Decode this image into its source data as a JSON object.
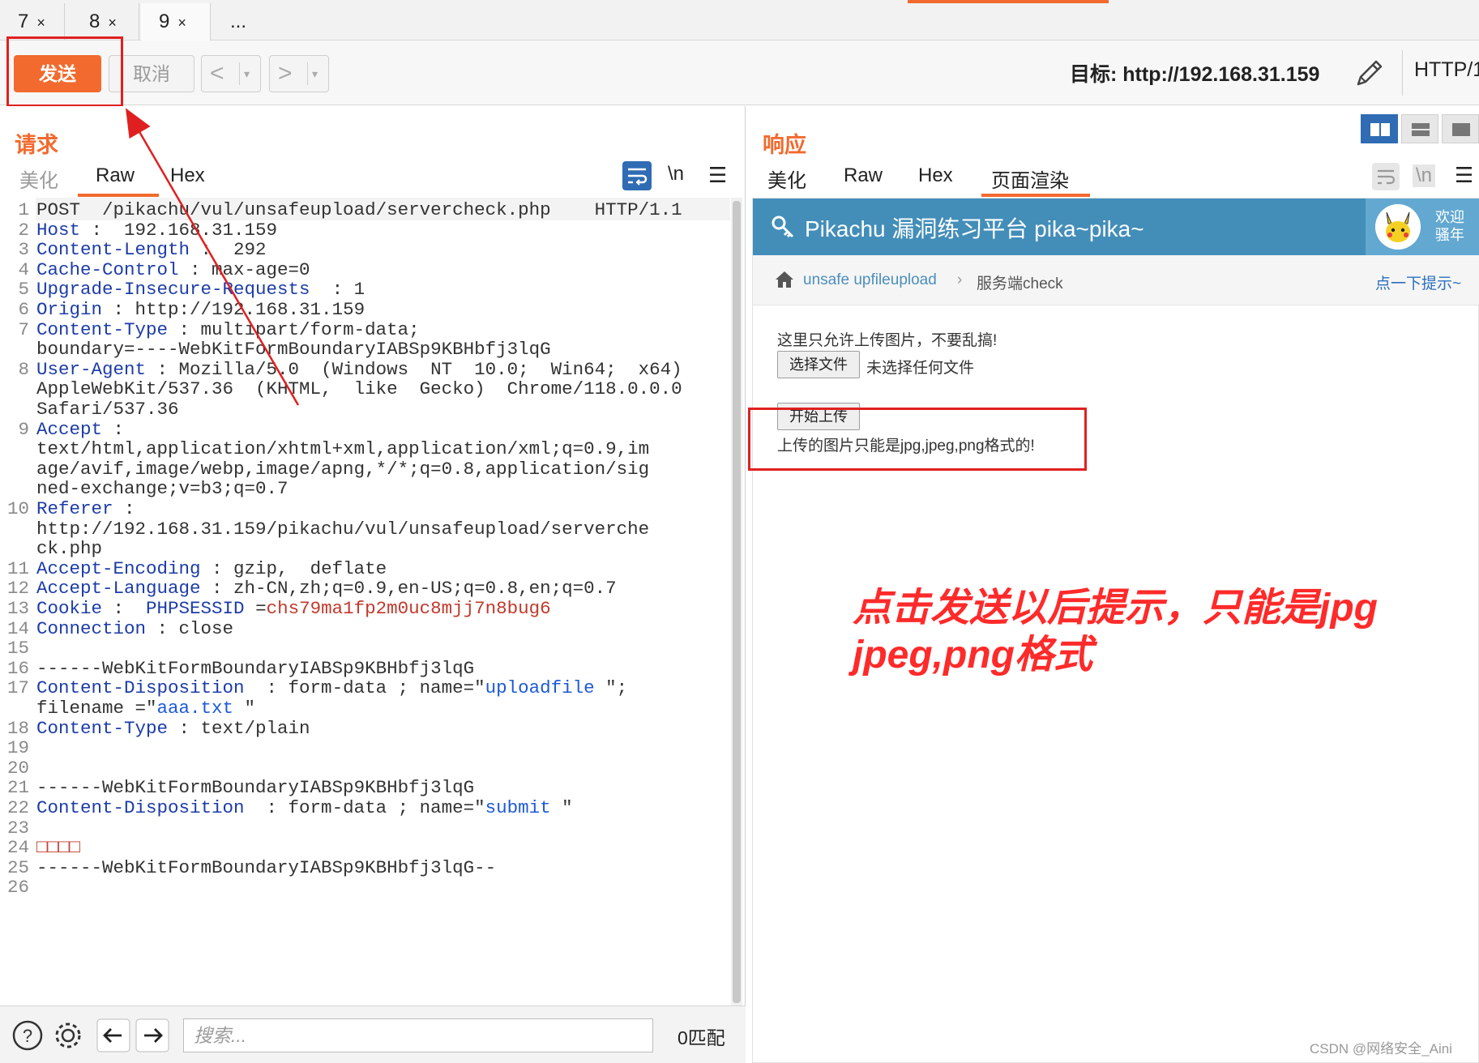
{
  "tabs": [
    {
      "label": "7",
      "close": "×"
    },
    {
      "label": "8",
      "close": "×"
    },
    {
      "label": "9",
      "close": "×"
    },
    {
      "label": "..."
    }
  ],
  "toolbar": {
    "send_label": "发送",
    "cancel_label": "取消",
    "back_glyph": "<",
    "forward_glyph": ">",
    "dropdown_glyph": "▾",
    "target_label": "目标: http://192.168.31.159",
    "protocol_label": "HTTP/1"
  },
  "request": {
    "title": "请求",
    "tabs": [
      "美化",
      "Raw",
      "Hex"
    ],
    "active_tab": "Raw",
    "newline_toggle": "\\n",
    "lines": [
      {
        "n": "1",
        "parts": [
          [
            "POST  /pikachu/vul/unsafeupload/servercheck.php    HTTP/1.1",
            ""
          ]
        ]
      },
      {
        "n": "2",
        "parts": [
          [
            "Host",
            "k"
          ],
          [
            " :  192.168.31.159",
            ""
          ]
        ]
      },
      {
        "n": "3",
        "parts": [
          [
            "Content-Length",
            "k"
          ],
          [
            " :  292",
            ""
          ]
        ]
      },
      {
        "n": "4",
        "parts": [
          [
            "Cache-Control",
            "k"
          ],
          [
            " : max-age=0",
            ""
          ]
        ]
      },
      {
        "n": "5",
        "parts": [
          [
            "Upgrade-Insecure-Requests",
            "k"
          ],
          [
            "  : 1",
            ""
          ]
        ]
      },
      {
        "n": "6",
        "parts": [
          [
            "Origin",
            "k"
          ],
          [
            " : http://192.168.31.159",
            ""
          ]
        ]
      },
      {
        "n": "7",
        "parts": [
          [
            "Content-Type",
            "k"
          ],
          [
            " : multipart/form-data;",
            ""
          ]
        ]
      },
      {
        "n": "",
        "parts": [
          [
            "boundary=----WebKitFormBoundaryIABSp9KBHbfj3lqG",
            ""
          ]
        ]
      },
      {
        "n": "8",
        "parts": [
          [
            "User-Agent",
            "k"
          ],
          [
            " : Mozilla/5.0  (Windows  NT  10.0;  Win64;  x64)",
            ""
          ]
        ]
      },
      {
        "n": "",
        "parts": [
          [
            "AppleWebKit/537.36  (KHTML,  like  Gecko)  Chrome/118.0.0.0",
            ""
          ]
        ]
      },
      {
        "n": "",
        "parts": [
          [
            "Safari/537.36",
            ""
          ]
        ]
      },
      {
        "n": "9",
        "parts": [
          [
            "Accept",
            "k"
          ],
          [
            " :",
            ""
          ]
        ]
      },
      {
        "n": "",
        "parts": [
          [
            "text/html,application/xhtml+xml,application/xml;q=0.9,im",
            ""
          ]
        ]
      },
      {
        "n": "",
        "parts": [
          [
            "age/avif,image/webp,image/apng,*/*;q=0.8,application/sig",
            ""
          ]
        ]
      },
      {
        "n": "",
        "parts": [
          [
            "ned-exchange;v=b3;q=0.7",
            ""
          ]
        ]
      },
      {
        "n": "10",
        "parts": [
          [
            "Referer",
            "k"
          ],
          [
            " :",
            ""
          ]
        ]
      },
      {
        "n": "",
        "parts": [
          [
            "http://192.168.31.159/pikachu/vul/unsafeupload/serverche",
            ""
          ]
        ]
      },
      {
        "n": "",
        "parts": [
          [
            "ck.php",
            ""
          ]
        ]
      },
      {
        "n": "11",
        "parts": [
          [
            "Accept-Encoding",
            "k"
          ],
          [
            " : gzip,  deflate",
            ""
          ]
        ]
      },
      {
        "n": "12",
        "parts": [
          [
            "Accept-Language",
            "k"
          ],
          [
            " : zh-CN,zh;q=0.9,en-US;q=0.8,en;q=0.7",
            ""
          ]
        ]
      },
      {
        "n": "13",
        "parts": [
          [
            "Cookie",
            "k"
          ],
          [
            " :  ",
            ""
          ],
          [
            "PHPSESSID",
            "k"
          ],
          [
            " =",
            ""
          ],
          [
            "chs79ma1fp2m0uc8mjj7n8bug6",
            "v"
          ]
        ]
      },
      {
        "n": "14",
        "parts": [
          [
            "Connection",
            "k"
          ],
          [
            " : close",
            ""
          ]
        ]
      },
      {
        "n": "15",
        "parts": [
          [
            "",
            ""
          ]
        ]
      },
      {
        "n": "16",
        "parts": [
          [
            "------WebKitFormBoundaryIABSp9KBHbfj3lqG",
            ""
          ]
        ]
      },
      {
        "n": "17",
        "parts": [
          [
            "Content-Disposition",
            "k"
          ],
          [
            "  : form-data ; name=\"",
            ""
          ],
          [
            "uploadfile",
            "b"
          ],
          [
            " \";",
            ""
          ]
        ]
      },
      {
        "n": "",
        "parts": [
          [
            "filename =\"",
            ""
          ],
          [
            "aaa.txt",
            "b"
          ],
          [
            " \"",
            ""
          ]
        ]
      },
      {
        "n": "18",
        "parts": [
          [
            "Content-Type",
            "k"
          ],
          [
            " : text/plain",
            ""
          ]
        ]
      },
      {
        "n": "19",
        "parts": [
          [
            "",
            ""
          ]
        ]
      },
      {
        "n": "20",
        "parts": [
          [
            "",
            ""
          ]
        ]
      },
      {
        "n": "21",
        "parts": [
          [
            "------WebKitFormBoundaryIABSp9KBHbfj3lqG",
            ""
          ]
        ]
      },
      {
        "n": "22",
        "parts": [
          [
            "Content-Disposition",
            "k"
          ],
          [
            "  : form-data ; name=\"",
            ""
          ],
          [
            "submit",
            "b"
          ],
          [
            " \"",
            ""
          ]
        ]
      },
      {
        "n": "23",
        "parts": [
          [
            "",
            ""
          ]
        ]
      },
      {
        "n": "24",
        "parts": [
          [
            "□□□□",
            "v"
          ]
        ]
      },
      {
        "n": "25",
        "parts": [
          [
            "------WebKitFormBoundaryIABSp9KBHbfj3lqG--",
            ""
          ]
        ]
      },
      {
        "n": "26",
        "parts": [
          [
            "",
            ""
          ]
        ]
      }
    ],
    "search_placeholder": "搜索...",
    "match_count": "0匹配"
  },
  "response": {
    "title": "响应",
    "tabs": [
      "美化",
      "Raw",
      "Hex",
      "页面渲染"
    ],
    "active_tab": "页面渲染",
    "newline_toggle": "\\n",
    "rendered_page": {
      "site_title": "Pikachu 漏洞练习平台 pika~pika~",
      "welcome_line1": "欢迎",
      "welcome_line2": "骚年",
      "breadcrumb_1": "unsafe upfileupload",
      "breadcrumb_sep": "›",
      "breadcrumb_2": "服务端check",
      "hint_link": "点一下提示~",
      "note": "这里只允许上传图片，不要乱搞!",
      "choose_file_btn": "选择文件",
      "no_file_text": "未选择任何文件",
      "upload_btn": "开始上传",
      "result_msg": "上传的图片只能是jpg,jpeg,png格式的!"
    }
  },
  "annotation": "点击发送以后提示，只能是jpg\njpeg,png格式",
  "watermark": "CSDN @网络安全_Aini",
  "colors": {
    "accent": "#f26a2e",
    "highlight_red": "#e02020",
    "pikachu_header": "#438eb9",
    "header_key": "#1c3ca8",
    "value_red": "#c0392b"
  }
}
